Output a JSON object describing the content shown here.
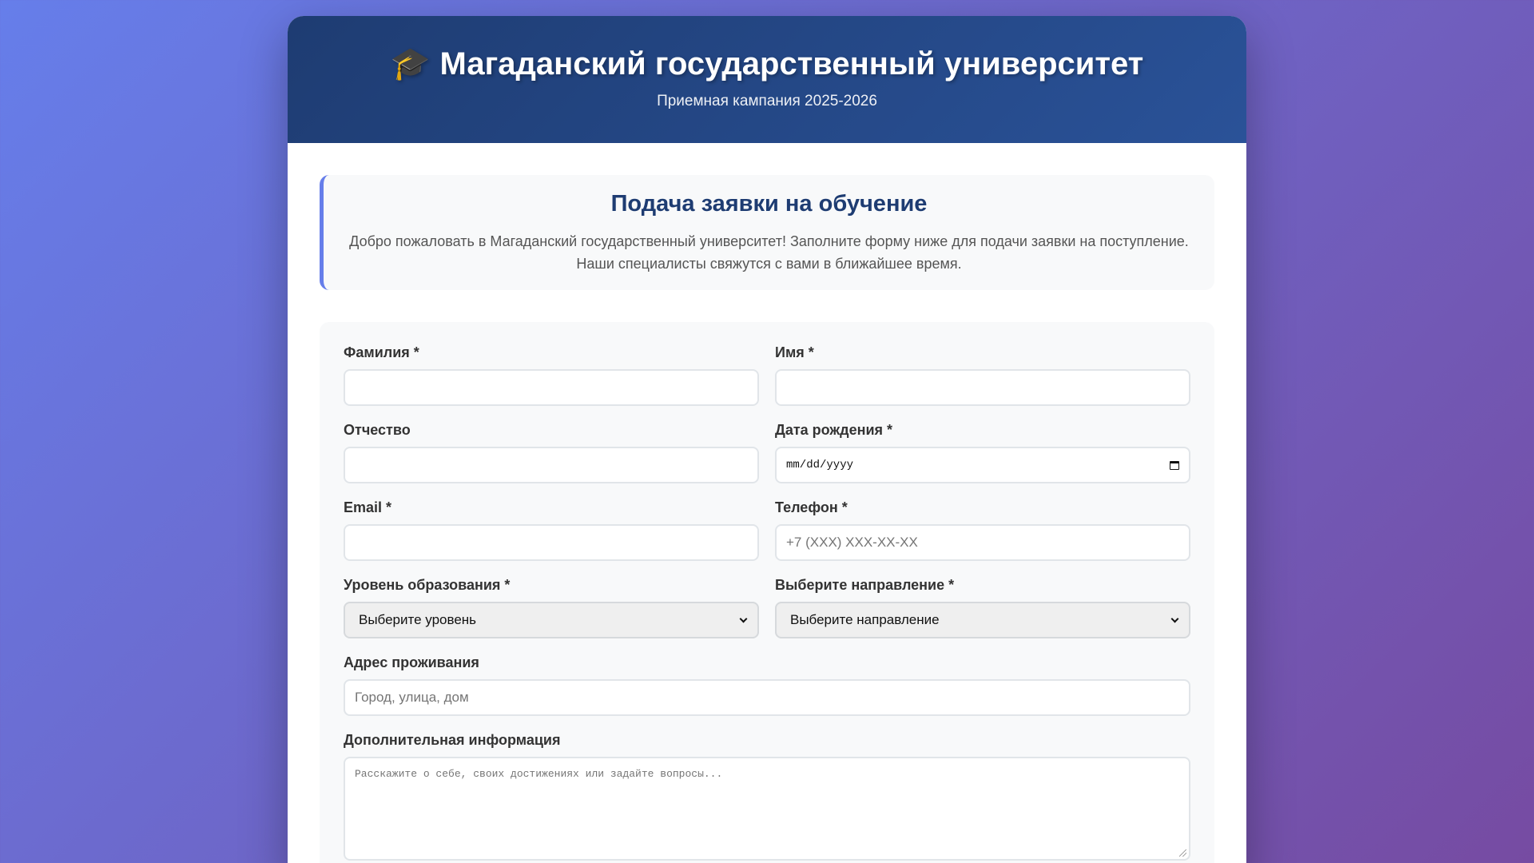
{
  "header": {
    "title": "Магаданский государственный университет",
    "icon": "graduation-cap-icon",
    "subtitle": "Приемная кампания 2025-2026"
  },
  "welcome": {
    "title": "Подача заявки на обучение",
    "text_line1": "Добро пожаловать в Магаданский государственный университет! Заполните форму ниже для подачи заявки на поступление.",
    "text_line2": "Наши специалисты свяжутся с вами в ближайшее время."
  },
  "form": {
    "last_name": {
      "label": "Фамилия *",
      "value": ""
    },
    "first_name": {
      "label": "Имя *",
      "value": ""
    },
    "patronymic": {
      "label": "Отчество",
      "value": ""
    },
    "birth_date": {
      "label": "Дата рождения *",
      "placeholder": "mm/dd/yyyy"
    },
    "email": {
      "label": "Email *",
      "value": ""
    },
    "phone": {
      "label": "Телефон *",
      "placeholder": "+7 (XXX) XXX-XX-XX"
    },
    "education_level": {
      "label": "Уровень образования *",
      "selected": "Выберите уровень"
    },
    "direction": {
      "label": "Выберите направление *",
      "selected": "Выберите направление"
    },
    "address": {
      "label": "Адрес проживания",
      "placeholder": "Город, улица, дом"
    },
    "additional": {
      "label": "Дополнительная информация",
      "placeholder": "Расскажите о себе, своих достижениях или задайте вопросы..."
    }
  },
  "colors": {
    "header_start": "#1e3c72",
    "header_end": "#2a5298",
    "accent": "#667eea",
    "bg_start": "#667eea",
    "bg_end": "#764ba2"
  }
}
